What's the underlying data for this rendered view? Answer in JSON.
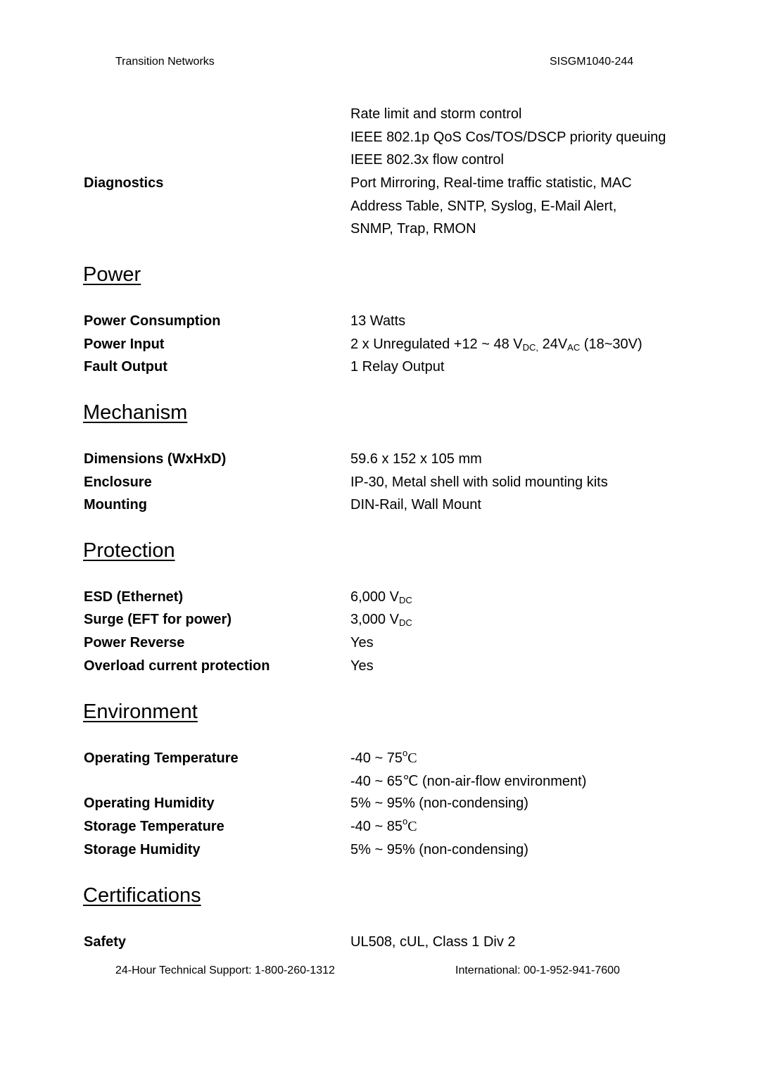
{
  "header": {
    "left": "Transition Networks",
    "right": "SISGM1040-244"
  },
  "continued": {
    "lines": [
      "Rate limit and storm control",
      "IEEE 802.1p QoS Cos/TOS/DSCP priority queuing",
      "IEEE 802.3x flow control"
    ],
    "diagnostics": {
      "label": "Diagnostics",
      "lines": [
        "Port Mirroring, Real-time traffic statistic, MAC",
        "Address Table, SNTP, Syslog, E-Mail Alert,",
        "SNMP, Trap, RMON"
      ]
    }
  },
  "sections": {
    "power": {
      "title": "Power",
      "rows": [
        {
          "label": "Power Consumption",
          "value": "13 Watts"
        },
        {
          "label": "Power Input",
          "value_prefix": "2 x Unregulated +12 ~ 48 V",
          "sub1": "DC,",
          "mid": " 24V",
          "sub2": "AC",
          "suffix": " (18~30V)"
        },
        {
          "label": "Fault Output",
          "value": "1 Relay Output"
        }
      ]
    },
    "mechanism": {
      "title": "Mechanism",
      "rows": [
        {
          "label": "Dimensions (WxHxD)",
          "value": "59.6 x 152 x 105 mm"
        },
        {
          "label": "Enclosure",
          "value": "IP-30, Metal shell with solid mounting kits"
        },
        {
          "label": "Mounting",
          "value": "DIN-Rail, Wall Mount"
        }
      ]
    },
    "protection": {
      "title": "Protection",
      "rows": [
        {
          "label": "ESD (Ethernet)",
          "value": "6,000 V",
          "sub": "DC"
        },
        {
          "label": "Surge (EFT for power)",
          "value": "3,000 V",
          "sub": "DC"
        },
        {
          "label": "Power Reverse",
          "value": "Yes"
        },
        {
          "label": "Overload current protection",
          "value": "Yes"
        }
      ]
    },
    "environment": {
      "title": "Environment",
      "rows": [
        {
          "label": "Operating Temperature",
          "value": "-40 ~ 75",
          "sup": "o",
          "unit": "C"
        },
        {
          "label": "",
          "value": "-40 ~ 65",
          "unit": "℃",
          "suffix": " (non-air-flow environment)"
        },
        {
          "label": "Operating Humidity",
          "value": "5% ~ 95% (non-condensing)"
        },
        {
          "label": "Storage Temperature",
          "value": "-40 ~ 85",
          "sup": "o",
          "unit": "C"
        },
        {
          "label": "Storage Humidity",
          "value": "5% ~ 95% (non-condensing)"
        }
      ]
    },
    "certifications": {
      "title": "Certifications",
      "rows": [
        {
          "label": "Safety",
          "value": "UL508, cUL, Class 1 Div 2"
        }
      ]
    }
  },
  "footer": {
    "support": "24-Hour Technical Support: 1-800-260-1312",
    "international": "International: 00-1-952-941-7600"
  }
}
